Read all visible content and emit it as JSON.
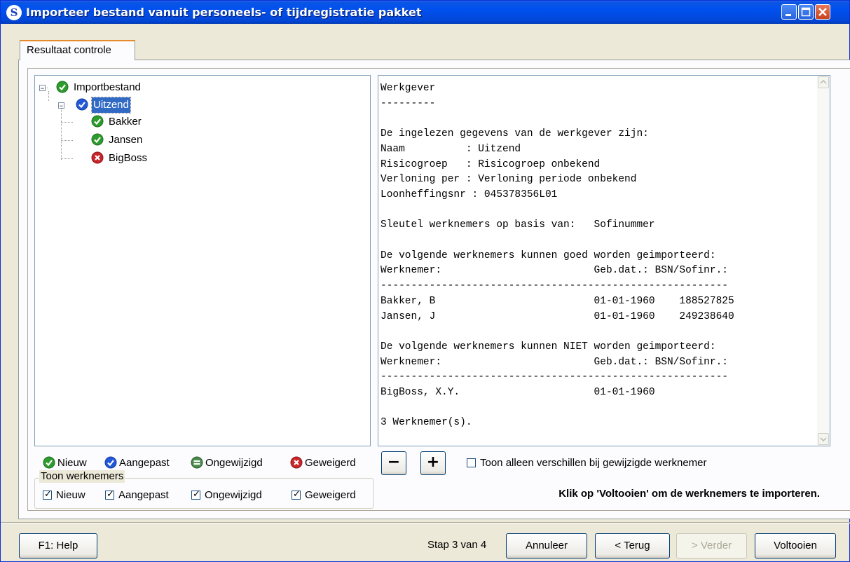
{
  "window": {
    "title": "Importeer bestand vanuit personeels- of tijdregistratie pakket",
    "app_icon": "S",
    "controls": [
      "minimize-icon",
      "maximize-icon",
      "close-icon"
    ]
  },
  "tabs": [
    {
      "label": "Resultaat controle",
      "active": true
    }
  ],
  "tree": {
    "root": {
      "label": "Importbestand",
      "status": "nieuw",
      "expanded": true
    },
    "employer": {
      "label": "Uitzend",
      "status": "aangepast",
      "expanded": true,
      "selected": true
    },
    "employees": [
      {
        "label": "Bakker",
        "status": "nieuw"
      },
      {
        "label": "Jansen",
        "status": "nieuw"
      },
      {
        "label": "BigBoss",
        "status": "geweigerd"
      }
    ]
  },
  "report": {
    "lines": [
      "Werkgever",
      "---------",
      "",
      "De ingelezen gegevens van de werkgever zijn:",
      "Naam          : Uitzend",
      "Risicogroep   : Risicogroep onbekend",
      "Verloning per : Verloning periode onbekend",
      "Loonheffingsnr : 045378356L01",
      "",
      "Sleutel werknemers op basis van:   Sofinummer",
      "",
      "De volgende werknemers kunnen goed worden geimporteerd:",
      "Werknemer:                         Geb.dat.: BSN/Sofinr.:",
      "---------------------------------------------------------",
      "Bakker, B                          01-01-1960    188527825",
      "Jansen, J                          01-01-1960    249238640",
      "",
      "De volgende werknemers kunnen NIET worden geimporteerd:",
      "Werknemer:                         Geb.dat.: BSN/Sofinr.:",
      "---------------------------------------------------------",
      "BigBoss, X.Y.                      01-01-1960",
      "",
      "3 Werknemer(s)."
    ]
  },
  "legend": {
    "nieuw": "Nieuw",
    "aangepast": "Aangepast",
    "ongewijzigd": "Ongewijzigd",
    "geweigerd": "Geweigerd"
  },
  "filter": {
    "title": "Toon werknemers",
    "options": [
      {
        "label": "Nieuw",
        "checked": true
      },
      {
        "label": "Aangepast",
        "checked": true
      },
      {
        "label": "Ongewijzigd",
        "checked": true
      },
      {
        "label": "Geweigerd",
        "checked": true
      }
    ]
  },
  "zoom": {
    "minus": "−",
    "plus": "+"
  },
  "only_diff": {
    "label": "Toon alleen verschillen bij gewijzigde werknemer",
    "checked": false
  },
  "hint": "Klik op 'Voltooien' om de werknemers te importeren.",
  "footer": {
    "help": "F1: Help",
    "step": "Stap  3 van  4",
    "cancel": "Annuleer",
    "back": "< Terug",
    "next": "> Verder",
    "finish": "Voltooien"
  },
  "colors": {
    "nieuw": "#2e9b2e",
    "aangepast": "#2358d8",
    "ongewijzigd": "#4a8a4a",
    "geweigerd": "#c8262b",
    "selection": "#316ac5",
    "title_bar": "#0050ee"
  }
}
